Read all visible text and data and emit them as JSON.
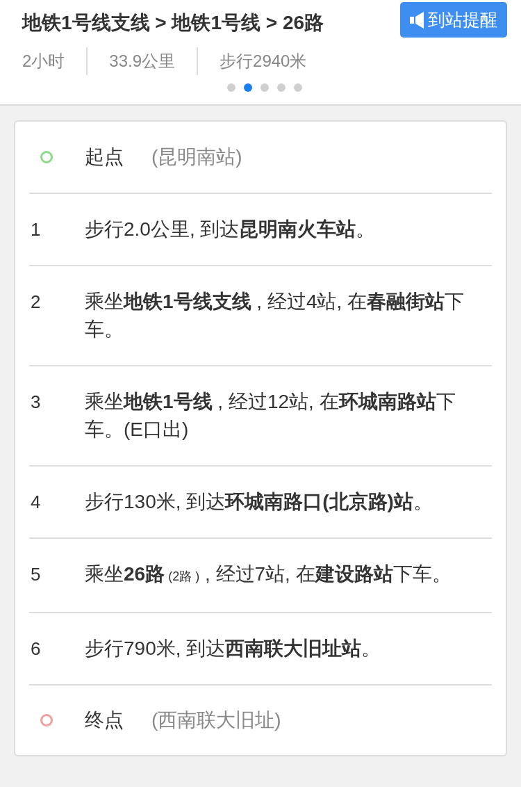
{
  "header": {
    "title": "地铁1号线支线 > 地铁1号线 > 26路",
    "alert_button": "到站提醒",
    "stats": [
      "2小时",
      "33.9公里",
      "步行2940米"
    ],
    "pager": [
      {
        "selected": false
      },
      {
        "selected": true
      },
      {
        "selected": false
      },
      {
        "selected": false
      },
      {
        "selected": false
      }
    ]
  },
  "route": {
    "start": {
      "label": "起点",
      "place": "(昆明南站)",
      "color": "#8fd98a"
    },
    "steps": [
      {
        "number": "1",
        "segments": [
          {
            "text": "步行2.0公里, 到达",
            "kind": "plain"
          },
          {
            "text": "昆明南火车站",
            "kind": "bold"
          },
          {
            "text": "。",
            "kind": "plain"
          }
        ]
      },
      {
        "number": "2",
        "segments": [
          {
            "text": "乘坐",
            "kind": "plain"
          },
          {
            "text": "地铁1号线支线",
            "kind": "bold"
          },
          {
            "text": " , 经过4站, 在",
            "kind": "plain"
          },
          {
            "text": "春融街站",
            "kind": "bold"
          },
          {
            "text": "下车。",
            "kind": "plain"
          }
        ]
      },
      {
        "number": "3",
        "segments": [
          {
            "text": "乘坐",
            "kind": "plain"
          },
          {
            "text": "地铁1号线",
            "kind": "bold"
          },
          {
            "text": " , 经过12站, 在",
            "kind": "plain"
          },
          {
            "text": "环城南路站",
            "kind": "bold"
          },
          {
            "text": "下车。(E口出)",
            "kind": "plain"
          }
        ]
      },
      {
        "number": "4",
        "segments": [
          {
            "text": "步行130米, 到达",
            "kind": "plain"
          },
          {
            "text": "环城南路口(北京路)站",
            "kind": "bold"
          },
          {
            "text": "。",
            "kind": "plain"
          }
        ]
      },
      {
        "number": "5",
        "segments": [
          {
            "text": "乘坐",
            "kind": "plain"
          },
          {
            "text": "26路",
            "kind": "bold"
          },
          {
            "text": " (2路 )",
            "kind": "small"
          },
          {
            "text": " , 经过7站, 在",
            "kind": "plain"
          },
          {
            "text": "建设路站",
            "kind": "bold"
          },
          {
            "text": "下车。",
            "kind": "plain"
          }
        ]
      },
      {
        "number": "6",
        "segments": [
          {
            "text": "步行790米, 到达",
            "kind": "plain"
          },
          {
            "text": "西南联大旧址站",
            "kind": "bold"
          },
          {
            "text": "。",
            "kind": "plain"
          }
        ]
      }
    ],
    "end": {
      "label": "终点",
      "place": "(西南联大旧址)",
      "color": "#f0a0a0"
    }
  }
}
